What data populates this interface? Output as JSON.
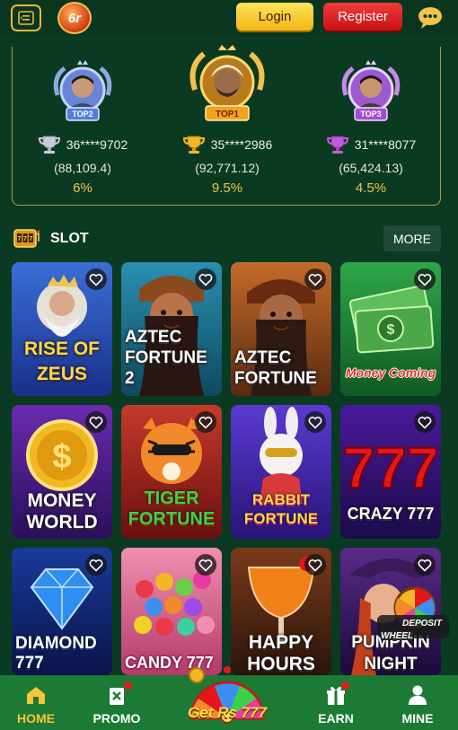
{
  "header": {
    "login_label": "Login",
    "register_label": "Register",
    "logo_text": "6r"
  },
  "leaderboard": [
    {
      "rank_badge": "TOP2",
      "user_id": "36****9702",
      "amount": "(88,109.4)",
      "percent": "6%"
    },
    {
      "rank_badge": "TOP1",
      "user_id": "35****2986",
      "amount": "(92,771.12)",
      "percent": "9.5%"
    },
    {
      "rank_badge": "TOP3",
      "user_id": "31****8077",
      "amount": "(65,424.13)",
      "percent": "4.5%"
    }
  ],
  "section": {
    "title": "SLOT",
    "more_label": "MORE"
  },
  "games": [
    {
      "title": "RISE OF ZEUS"
    },
    {
      "title": "AZTEC FORTUNE 2"
    },
    {
      "title": "AZTEC FORTUNE"
    },
    {
      "title": "Money Coming"
    },
    {
      "title": "MONEY WORLD"
    },
    {
      "title": "TIGER FORTUNE"
    },
    {
      "title": "RABBIT FORTUNE"
    },
    {
      "title": "CRAZY 777"
    },
    {
      "title": "DIAMOND 777"
    },
    {
      "title": "CANDY 777"
    },
    {
      "title": "HAPPY HOURS"
    },
    {
      "title": "PUMPKIN NIGHT"
    }
  ],
  "floating": {
    "deposit_line1": "DEPOSIT",
    "deposit_line2": "WHEEL"
  },
  "nav": {
    "home": "HOME",
    "promo": "PROMO",
    "wheel": "Get Rs 777",
    "earn": "EARN",
    "mine": "MINE"
  },
  "colors": {
    "background": "#0b3a22",
    "accent_gold": "#f1c34a",
    "nav_green": "#1c7a35",
    "register_red": "#c81212"
  }
}
